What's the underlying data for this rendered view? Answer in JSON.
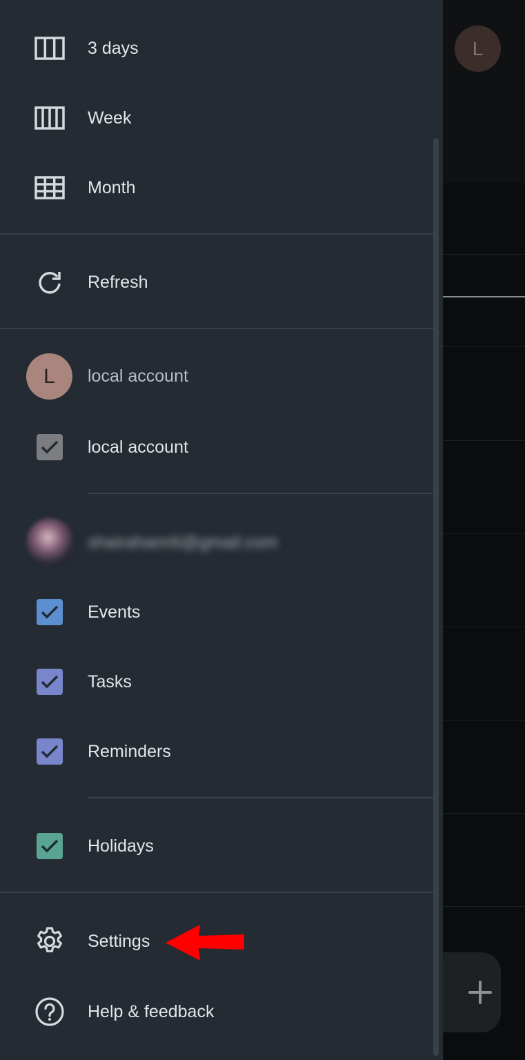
{
  "background": {
    "avatar_letter": "L",
    "fab_icon": "plus-icon"
  },
  "drawer": {
    "views": [
      {
        "label": "3 days",
        "icon": "three-day-view-icon"
      },
      {
        "label": "Week",
        "icon": "week-view-icon"
      },
      {
        "label": "Month",
        "icon": "month-view-icon"
      }
    ],
    "refresh": {
      "label": "Refresh",
      "icon": "refresh-icon"
    },
    "local_account": {
      "avatar_letter": "L",
      "header": "local account",
      "calendar": {
        "label": "local account",
        "checked": true,
        "color": "#7b7d80"
      }
    },
    "google_account": {
      "email": "shairahanriti@gmail.com",
      "calendars": [
        {
          "label": "Events",
          "checked": true,
          "color": "#5b8fcf"
        },
        {
          "label": "Tasks",
          "checked": true,
          "color": "#7986cb"
        },
        {
          "label": "Reminders",
          "checked": true,
          "color": "#7986cb"
        }
      ]
    },
    "other_calendars": [
      {
        "label": "Holidays",
        "checked": true,
        "color": "#5aa494"
      }
    ],
    "footer": {
      "settings": {
        "label": "Settings",
        "icon": "gear-icon"
      },
      "help": {
        "label": "Help & feedback",
        "icon": "help-icon"
      }
    }
  },
  "annotation": {
    "arrow_color": "#ff0000"
  }
}
